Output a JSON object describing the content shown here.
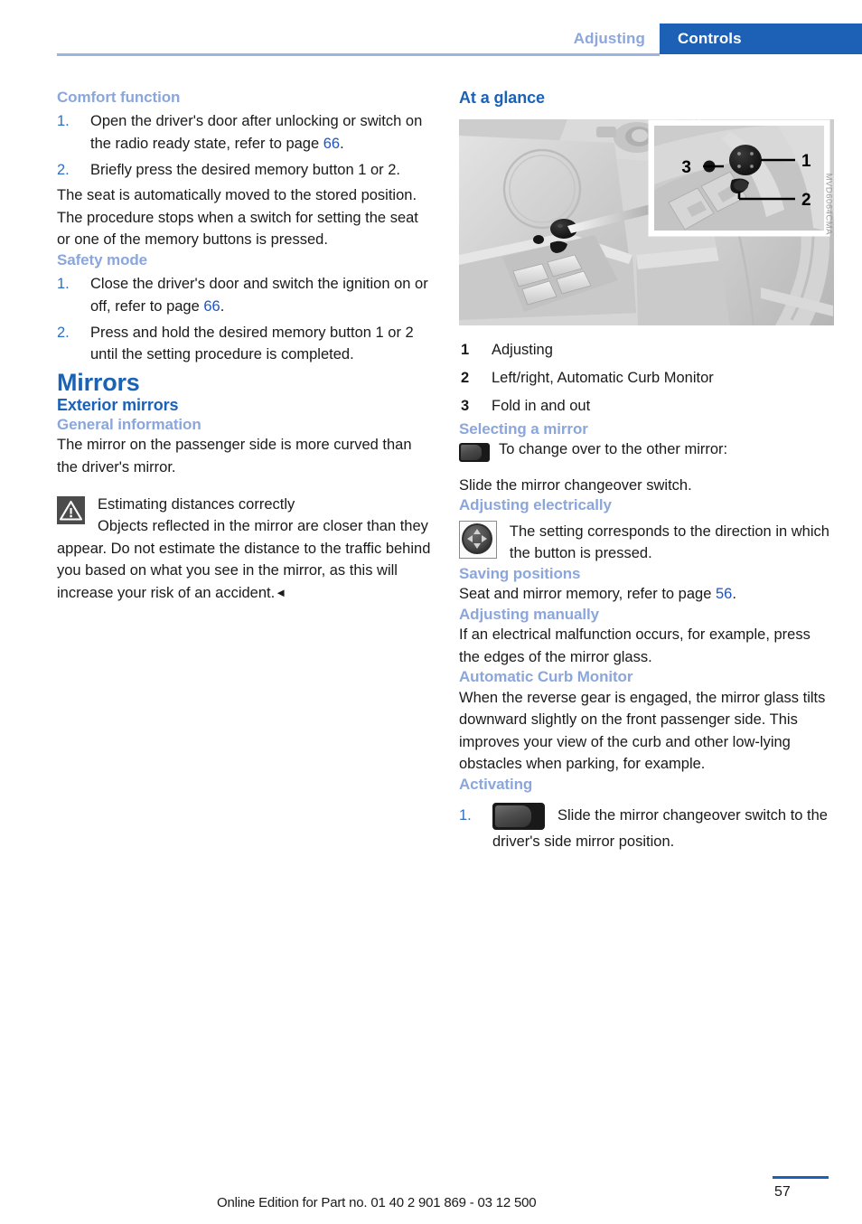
{
  "header": {
    "chapter_label": "Adjusting",
    "tab_label": "Controls"
  },
  "colors": {
    "accent_blue": "#1c61b5",
    "heading_blue": "#1a62b8",
    "subhead_blue": "#8ba6db",
    "link_blue": "#1a55c8"
  },
  "left_column": {
    "comfort": {
      "heading": "Comfort function",
      "steps": [
        {
          "num": "1.",
          "pre": "Open the driver's door after unlocking or switch on the radio ready state, refer to page ",
          "ref": "66",
          "post": "."
        },
        {
          "num": "2.",
          "pre": "Briefly press the desired memory button 1 or 2.",
          "ref": "",
          "post": ""
        }
      ],
      "para1": "The seat is automatically moved to the stored position.",
      "para2": "The procedure stops when a switch for setting the seat or one of the memory buttons is pressed."
    },
    "safety": {
      "heading": "Safety mode",
      "steps": [
        {
          "num": "1.",
          "pre": "Close the driver's door and switch the ignition on or off, refer to page ",
          "ref": "66",
          "post": "."
        },
        {
          "num": "2.",
          "pre": "Press and hold the desired memory button 1 or 2 until the setting procedure is completed.",
          "ref": "",
          "post": ""
        }
      ]
    },
    "mirrors_title": "Mirrors",
    "exterior_mirrors_heading": "Exterior mirrors",
    "general_info": {
      "heading": "General information",
      "para": "The mirror on the passenger side is more curved than the driver's mirror.",
      "warning_title": "Estimating distances correctly",
      "warning_body": "Objects reflected in the mirror are closer than they appear. Do not estimate the distance to the traffic behind you based on what you see in the mirror, as this will increase your risk of an accident.",
      "warning_end_mark": "◄"
    }
  },
  "right_column": {
    "at_a_glance": {
      "heading": "At a glance",
      "image_code": "MVD6064CMA",
      "inset_callouts": [
        "1",
        "2",
        "3"
      ],
      "legend": [
        {
          "num": "1",
          "text": "Adjusting"
        },
        {
          "num": "2",
          "text": "Left/right, Automatic Curb Monitor"
        },
        {
          "num": "3",
          "text": "Fold in and out"
        }
      ]
    },
    "selecting_mirror": {
      "heading": "Selecting a mirror",
      "icon": "mirror-changeover-switch-icon",
      "line1": "To change over to the other mirror:",
      "line2": "Slide the mirror changeover switch."
    },
    "adjusting_electrically": {
      "heading": "Adjusting electrically",
      "icon": "mirror-dpad-button-icon",
      "text": "The setting corresponds to the direction in which the button is pressed."
    },
    "saving_positions": {
      "heading": "Saving positions",
      "pre": "Seat and mirror memory, refer to page ",
      "ref": "56",
      "post": "."
    },
    "adjusting_manually": {
      "heading": "Adjusting manually",
      "text": "If an electrical malfunction occurs, for example, press the edges of the mirror glass."
    },
    "automatic_curb_monitor": {
      "heading": "Automatic Curb Monitor",
      "text": "When the reverse gear is engaged, the mirror glass tilts downward slightly on the front passenger side. This improves your view of the curb and other low-lying obstacles when parking, for example."
    },
    "activating": {
      "heading": "Activating",
      "step_num": "1.",
      "icon": "mirror-changeover-switch-icon",
      "text": "Slide the mirror changeover switch to the driver's side mirror position."
    }
  },
  "footer": {
    "edition_text": "Online Edition for Part no. 01 40 2 901 869 - 03 12 500",
    "page_number": "57"
  }
}
